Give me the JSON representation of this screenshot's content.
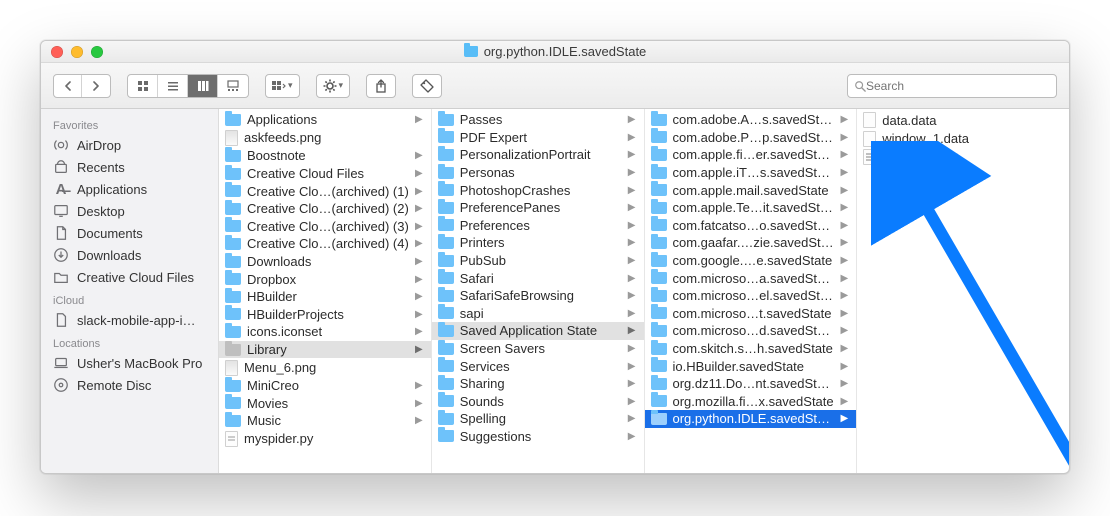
{
  "window": {
    "title": "org.python.IDLE.savedState"
  },
  "search": {
    "placeholder": "Search"
  },
  "sidebar": {
    "sections": [
      {
        "header": "Favorites",
        "items": [
          {
            "label": "AirDrop",
            "icon": "airdrop"
          },
          {
            "label": "Recents",
            "icon": "recents"
          },
          {
            "label": "Applications",
            "icon": "apps"
          },
          {
            "label": "Desktop",
            "icon": "desktop"
          },
          {
            "label": "Documents",
            "icon": "documents"
          },
          {
            "label": "Downloads",
            "icon": "downloads"
          },
          {
            "label": "Creative Cloud Files",
            "icon": "folder"
          }
        ]
      },
      {
        "header": "iCloud",
        "items": [
          {
            "label": "slack-mobile-app-i…",
            "icon": "file"
          }
        ]
      },
      {
        "header": "Locations",
        "items": [
          {
            "label": "Usher's MacBook Pro",
            "icon": "laptop"
          },
          {
            "label": "Remote Disc",
            "icon": "disc"
          }
        ]
      }
    ]
  },
  "columns": [
    {
      "items": [
        {
          "label": "Applications",
          "type": "folder",
          "chev": true
        },
        {
          "label": "askfeeds.png",
          "type": "img"
        },
        {
          "label": "Boostnote",
          "type": "folder",
          "chev": true
        },
        {
          "label": "Creative Cloud Files",
          "type": "folder",
          "chev": true
        },
        {
          "label": "Creative Clo…(archived) (1)",
          "type": "folder",
          "chev": true
        },
        {
          "label": "Creative Clo…(archived) (2)",
          "type": "folder",
          "chev": true
        },
        {
          "label": "Creative Clo…(archived) (3)",
          "type": "folder",
          "chev": true
        },
        {
          "label": "Creative Clo…(archived) (4)",
          "type": "folder",
          "chev": true
        },
        {
          "label": "Downloads",
          "type": "folder",
          "chev": true
        },
        {
          "label": "Dropbox",
          "type": "folder",
          "chev": true
        },
        {
          "label": "HBuilder",
          "type": "folder",
          "chev": true
        },
        {
          "label": "HBuilderProjects",
          "type": "folder",
          "chev": true
        },
        {
          "label": "icons.iconset",
          "type": "folder",
          "chev": true
        },
        {
          "label": "Library",
          "type": "folder-dim",
          "chev": true,
          "selected": "grey"
        },
        {
          "label": "Menu_6.png",
          "type": "img"
        },
        {
          "label": "MiniCreo",
          "type": "folder",
          "chev": true
        },
        {
          "label": "Movies",
          "type": "folder",
          "chev": true
        },
        {
          "label": "Music",
          "type": "folder",
          "chev": true
        },
        {
          "label": "myspider.py",
          "type": "py"
        }
      ]
    },
    {
      "items": [
        {
          "label": "Passes",
          "type": "folder",
          "chev": true
        },
        {
          "label": "PDF Expert",
          "type": "folder",
          "chev": true
        },
        {
          "label": "PersonalizationPortrait",
          "type": "folder",
          "chev": true
        },
        {
          "label": "Personas",
          "type": "folder",
          "chev": true
        },
        {
          "label": "PhotoshopCrashes",
          "type": "folder",
          "chev": true
        },
        {
          "label": "PreferencePanes",
          "type": "folder",
          "chev": true
        },
        {
          "label": "Preferences",
          "type": "folder",
          "chev": true
        },
        {
          "label": "Printers",
          "type": "folder",
          "chev": true
        },
        {
          "label": "PubSub",
          "type": "folder",
          "chev": true
        },
        {
          "label": "Safari",
          "type": "folder",
          "chev": true
        },
        {
          "label": "SafariSafeBrowsing",
          "type": "folder",
          "chev": true
        },
        {
          "label": "sapi",
          "type": "folder",
          "chev": true
        },
        {
          "label": "Saved Application State",
          "type": "folder",
          "chev": true,
          "selected": "grey"
        },
        {
          "label": "Screen Savers",
          "type": "folder",
          "chev": true
        },
        {
          "label": "Services",
          "type": "folder",
          "chev": true
        },
        {
          "label": "Sharing",
          "type": "folder",
          "chev": true
        },
        {
          "label": "Sounds",
          "type": "folder",
          "chev": true
        },
        {
          "label": "Spelling",
          "type": "folder",
          "chev": true
        },
        {
          "label": "Suggestions",
          "type": "folder",
          "chev": true
        }
      ]
    },
    {
      "items": [
        {
          "label": "com.adobe.A…s.savedState",
          "type": "folder",
          "chev": true
        },
        {
          "label": "com.adobe.P…p.savedState",
          "type": "folder",
          "chev": true
        },
        {
          "label": "com.apple.fi…er.savedState",
          "type": "folder",
          "chev": true
        },
        {
          "label": "com.apple.iT…s.savedState",
          "type": "folder",
          "chev": true
        },
        {
          "label": "com.apple.mail.savedState",
          "type": "folder",
          "chev": true
        },
        {
          "label": "com.apple.Te…it.savedState",
          "type": "folder",
          "chev": true
        },
        {
          "label": "com.fatcatso…o.savedState",
          "type": "folder",
          "chev": true
        },
        {
          "label": "com.gaafar.…zie.savedState",
          "type": "folder",
          "chev": true
        },
        {
          "label": "com.google.…e.savedState",
          "type": "folder",
          "chev": true
        },
        {
          "label": "com.microso…a.savedState",
          "type": "folder",
          "chev": true
        },
        {
          "label": "com.microso…el.savedState",
          "type": "folder",
          "chev": true
        },
        {
          "label": "com.microso…t.savedState",
          "type": "folder",
          "chev": true
        },
        {
          "label": "com.microso…d.savedState",
          "type": "folder",
          "chev": true
        },
        {
          "label": "com.skitch.s…h.savedState",
          "type": "folder",
          "chev": true
        },
        {
          "label": "io.HBuilder.savedState",
          "type": "folder",
          "chev": true
        },
        {
          "label": "org.dz11.Do…nt.savedState",
          "type": "folder",
          "chev": true
        },
        {
          "label": "org.mozilla.fi…x.savedState",
          "type": "folder",
          "chev": true
        },
        {
          "label": "org.python.IDLE.savedState",
          "type": "folder",
          "chev": true,
          "selected": "blue"
        }
      ]
    },
    {
      "items": [
        {
          "label": "data.data",
          "type": "file"
        },
        {
          "label": "window_1.data",
          "type": "file"
        },
        {
          "label": "windows.plist",
          "type": "plist"
        }
      ]
    }
  ]
}
